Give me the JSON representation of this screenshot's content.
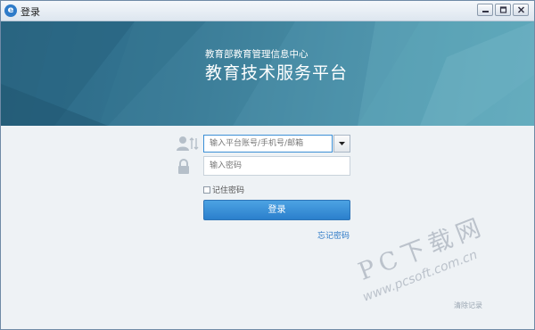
{
  "window": {
    "title": "登录",
    "app_icon_glyph": "e",
    "controls": [
      {
        "name": "minimize-button",
        "icon": "minimize-icon"
      },
      {
        "name": "maximize-button",
        "icon": "maximize-icon"
      },
      {
        "name": "close-button",
        "icon": "close-icon"
      }
    ]
  },
  "banner": {
    "subtitle": "教育部教育管理信息中心",
    "title": "教育技术服务平台"
  },
  "form": {
    "account": {
      "placeholder": "输入平台账号/手机号/邮箱",
      "icon": "user-switch-icon"
    },
    "password": {
      "placeholder": "输入密码",
      "icon": "lock-icon"
    },
    "remember_label": "记住密码",
    "remember_checked": false,
    "login_label": "登录",
    "forgot_label": "忘记密码",
    "clear_label": "清除记录"
  },
  "watermark": {
    "brand": "PC下载网",
    "url": "www.pcsoft.com.cn"
  },
  "colors": {
    "accent": "#2b7fcc",
    "banner": "#3d7e9a",
    "link": "#2a78c6",
    "background": "#eef2f5"
  }
}
